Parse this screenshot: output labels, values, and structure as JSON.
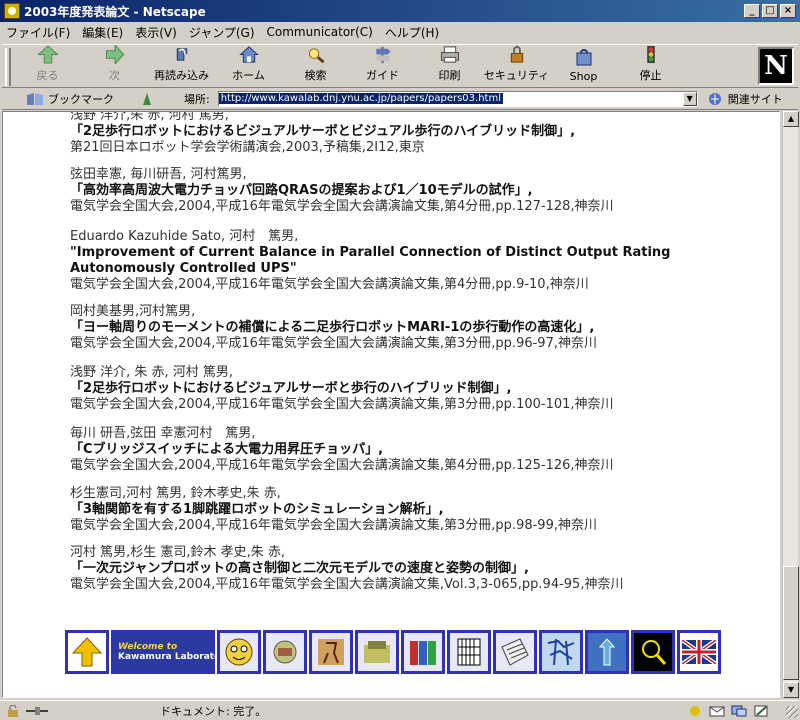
{
  "window": {
    "title": "2003年度発表論文 - Netscape"
  },
  "menu": [
    "ファイル(F)",
    "編集(E)",
    "表示(V)",
    "ジャンプ(G)",
    "Communicator(C)",
    "ヘルプ(H)"
  ],
  "toolbar": [
    {
      "label": "戻る",
      "icon": "back-arrow-icon",
      "disabled": true
    },
    {
      "label": "次",
      "icon": "forward-arrow-icon",
      "disabled": true
    },
    {
      "label": "再読み込み",
      "icon": "reload-icon"
    },
    {
      "label": "ホーム",
      "icon": "home-icon"
    },
    {
      "label": "検索",
      "icon": "search-icon"
    },
    {
      "label": "ガイド",
      "icon": "guide-icon"
    },
    {
      "label": "印刷",
      "icon": "print-icon"
    },
    {
      "label": "セキュリティ",
      "icon": "security-icon"
    },
    {
      "label": "Shop",
      "icon": "shop-icon"
    },
    {
      "label": "停止",
      "icon": "stop-icon"
    }
  ],
  "location": {
    "bookmark_label": "ブックマーク",
    "location_label": "場所:",
    "url": "http://www.kawalab.dnj.ynu.ac.jp/papers/papers03.html",
    "related_label": "関連サイト"
  },
  "entries": [
    {
      "authors": "浅野 洋介,朱 赤, 河村 篤男,",
      "title": "「2足歩行ロボットにおけるビジュアルサーボとビジュアル歩行のハイブリッド制御」,",
      "venue": "第21回日本ロボット学会学術講演会,2003,予稿集,2I12,東京"
    },
    {
      "authors": "弦田幸憲, 毎川研吾, 河村篤男,",
      "title": "「高効率高周波大電力チョッパ回路QRASの提案および1／10モデルの試作」,",
      "venue": "電気学会全国大会,2004,平成16年電気学会全国大会講演論文集,第4分冊,pp.127-128,神奈川"
    },
    {
      "authors": "Eduardo Kazuhide Sato, 河村　篤男,",
      "title": "\"Improvement of Current Balance in Parallel Connection of Distinct Output Rating",
      "title2": "Autonomously Controlled UPS\"",
      "venue": "電気学会全国大会,2004,平成16年電気学会全国大会講演論文集,第4分冊,pp.9-10,神奈川"
    },
    {
      "authors": "岡村美基男,河村篤男,",
      "title": "「ヨー軸周りのモーメントの補償による二足歩行ロボットMARI-1の歩行動作の高速化」,",
      "venue": "電気学会全国大会,2004,平成16年電気学会全国大会講演論文集,第3分冊,pp.96-97,神奈川"
    },
    {
      "authors": "浅野 洋介, 朱 赤, 河村 篤男,",
      "title": "「2足歩行ロボットにおけるビジュアルサーボと歩行のハイブリッド制御」,",
      "venue": "電気学会全国大会,2004,平成16年電気学会全国大会講演論文集,第3分冊,pp.100-101,神奈川"
    },
    {
      "authors": "毎川 研吾,弦田 幸憲河村　篤男,",
      "title": "「Cブリッジスイッチによる大電力用昇圧チョッパ」,",
      "venue": "電気学会全国大会,2004,平成16年電気学会全国大会講演論文集,第4分冊,pp.125-126,神奈川"
    },
    {
      "authors": "杉生憲司,河村 篤男, 鈴木孝史,朱 赤,",
      "title": "「3軸関節を有する1脚跳躍ロボットのシミュレーション解析」,",
      "venue": "電気学会全国大会,2004,平成16年電気学会全国大会講演論文集,第3分冊,pp.98-99,神奈川"
    },
    {
      "authors": "河村 篤男,杉生 憲司,鈴木 孝史,朱 赤,",
      "title": "「一次元ジャンプロボットの高さ制御と二次元モデルでの速度と姿勢の制御」,",
      "venue": "電気学会全国大会,2004,平成16年電気学会全国大会講演論文集,Vol.3,3-065,pp.94-95,神奈川"
    }
  ],
  "nav_banner": {
    "line1": "Welcome to",
    "line2": "Kawamura Laboratory"
  },
  "status": {
    "text": "ドキュメント: 完了。"
  }
}
